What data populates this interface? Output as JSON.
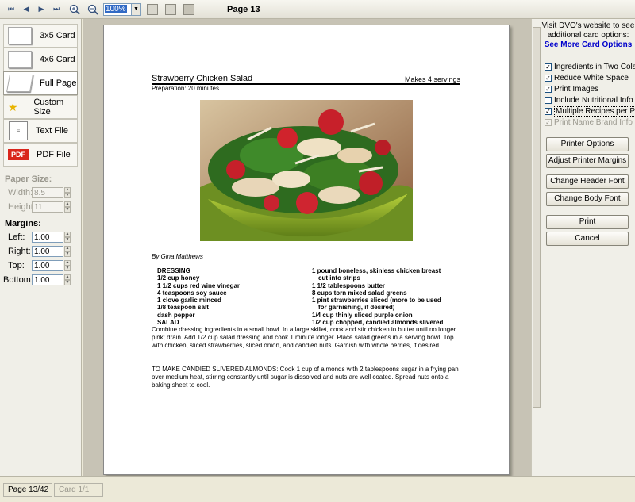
{
  "toolbar": {
    "zoom_value": "100%",
    "page_label": "Page 13"
  },
  "left": {
    "card_buttons": [
      {
        "label": "3x5 Card"
      },
      {
        "label": "4x6 Card"
      },
      {
        "label": "Full Page"
      },
      {
        "label": "Custom Size"
      },
      {
        "label": "Text File"
      },
      {
        "label": "PDF File"
      }
    ],
    "paper_size_label": "Paper Size:",
    "width_label": "Width:",
    "width_value": "8.5",
    "height_label": "Height:",
    "height_value": "11",
    "margins_label": "Margins:",
    "left_label": "Left:",
    "left_value": "1.00",
    "right_label": "Right:",
    "right_value": "1.00",
    "top_label": "Top:",
    "top_value": "1.00",
    "bottom_label": "Bottom:",
    "bottom_value": "1.00",
    "pdf_badge": "PDF"
  },
  "recipe": {
    "title": "Strawberry Chicken Salad",
    "servings": "Makes 4 servings",
    "prep": "Preparation: 20 minutes",
    "author": "By Gina Matthews",
    "ingredients_left": [
      "DRESSING",
      "1/2 cup honey",
      "1 1/2 cups red wine vinegar",
      "4 teaspoons soy sauce",
      "1 clove garlic minced",
      "1/8 teaspoon salt",
      "dash pepper",
      "SALAD"
    ],
    "ingredients_right": [
      "1 pound boneless, skinless chicken breast",
      "cut into strips",
      "1 1/2 tablespoons butter",
      "8 cups torn mixed salad greens",
      "1 pint strawberries sliced (more to be used",
      "for garnishing, if desired)",
      "1/4 cup thinly sliced purple onion",
      "1/2 cup chopped, candied almonds slivered"
    ],
    "instructions": "Combine dressing ingredients in a small bowl. In a large skillet, cook and stir chicken in butter until no longer pink; drain. Add 1/2 cup salad dressing and cook 1 minute longer. Place salad greens in a serving bowl. Top with chicken, sliced strawberries, sliced onion, and candied nuts. Garnish with whole berries, if desired.",
    "instructions2": "TO MAKE CANDIED SLIVERED ALMONDS: Cook 1 cup of almonds with 2 tablespoons sugar in a frying pan over medium heat, stirring constantly until sugar is dissolved and nuts are well coated. Spread nuts onto a baking sheet to cool."
  },
  "right": {
    "visit_text": "Visit DVO's website to see additional card options:",
    "link_text": "See More Card Options",
    "options": [
      {
        "label": "Ingredients in Two Cols",
        "checked": true
      },
      {
        "label": "Reduce White Space",
        "checked": true
      },
      {
        "label": "Print Images",
        "checked": true
      },
      {
        "label": "Include Nutritional Info",
        "checked": false
      },
      {
        "label": "Multiple Recipes per Page",
        "checked": true
      },
      {
        "label": "Print Name Brand Info",
        "checked": true
      }
    ],
    "check_mark": "✓",
    "buttons": {
      "printer_options": "Printer Options",
      "adjust_margins": "Adjust Printer Margins",
      "header_font": "Change Header Font",
      "body_font": "Change Body Font",
      "print": "Print",
      "cancel": "Cancel"
    }
  },
  "status": {
    "page": "Page 13/42",
    "card": "Card 1/1"
  }
}
